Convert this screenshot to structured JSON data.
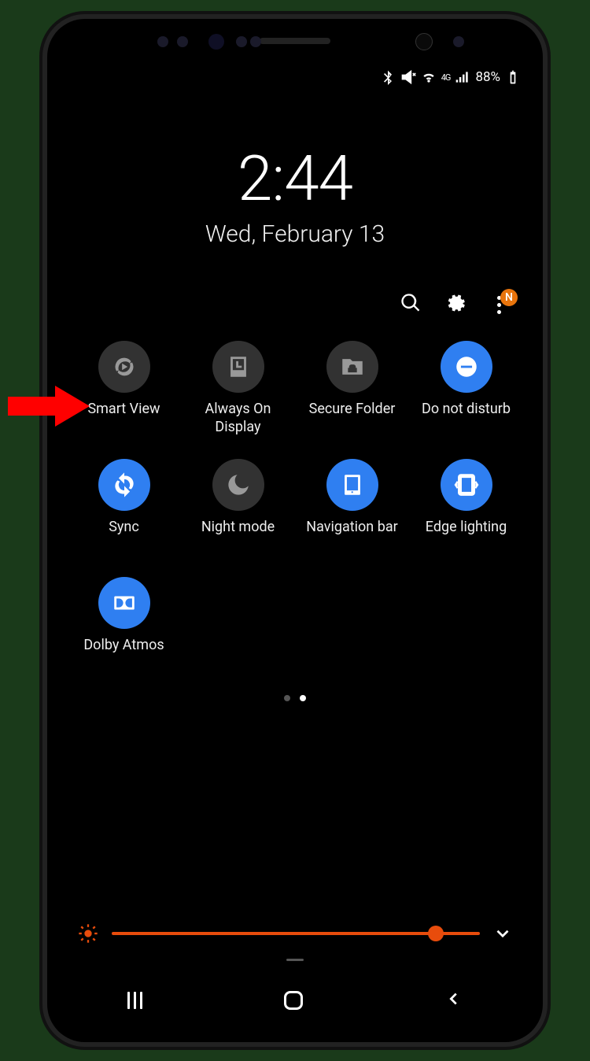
{
  "status_bar": {
    "battery_text": "88%",
    "network_text": "4G"
  },
  "clock": {
    "time": "2:44",
    "date": "Wed, February 13"
  },
  "more_badge": "N",
  "tiles": {
    "smart_view": "Smart View",
    "always_on_display": "Always On Display",
    "secure_folder": "Secure Folder",
    "do_not_disturb": "Do not disturb",
    "sync": "Sync",
    "night_mode": "Night mode",
    "navigation_bar": "Navigation bar",
    "edge_lighting": "Edge lighting",
    "dolby_atmos": "Dolby Atmos"
  },
  "brightness_percent": 88,
  "page_indicator": {
    "count": 2,
    "active_index": 1
  }
}
